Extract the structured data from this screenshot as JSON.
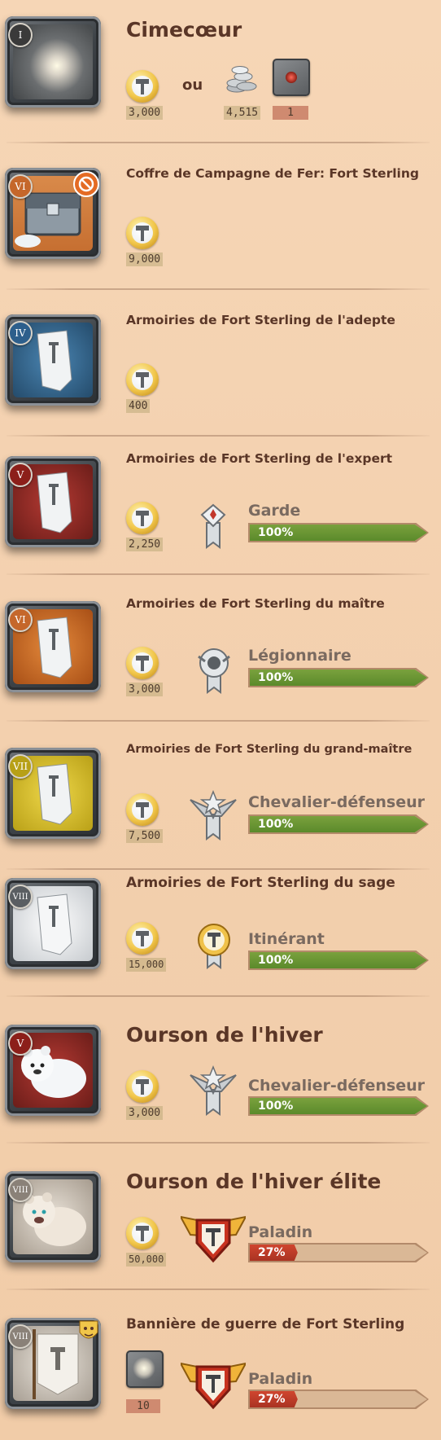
{
  "items": [
    {
      "tier": "I",
      "title": "Cimecœur",
      "price": "3,000",
      "ou": "ou",
      "alt_price": "4,515",
      "alt_count": "1"
    },
    {
      "tier": "VI",
      "title": "Coffre de Campagne de Fer: Fort Sterling",
      "price": "9,000"
    },
    {
      "tier": "IV",
      "title": "Armoiries de Fort Sterling de l'adepte",
      "price": "400"
    },
    {
      "tier": "V",
      "title": "Armoiries de Fort Sterling de l'expert",
      "price": "2,250",
      "rank": "Garde",
      "progress_label": "100%",
      "progress": 1.0
    },
    {
      "tier": "VI",
      "title": "Armoiries de Fort Sterling du maître",
      "price": "3,000",
      "rank": "Légionnaire",
      "progress_label": "100%",
      "progress": 1.0
    },
    {
      "tier": "VII",
      "title": "Armoiries de Fort Sterling du grand-maître",
      "price": "7,500",
      "rank": "Chevalier-défenseur",
      "progress_label": "100%",
      "progress": 1.0
    },
    {
      "tier": "VIII",
      "title": "Armoiries de Fort Sterling du sage",
      "price": "15,000",
      "rank": "Itinérant",
      "progress_label": "100%",
      "progress": 1.0
    },
    {
      "tier": "V",
      "title": "Ourson de l'hiver",
      "price": "3,000",
      "rank": "Chevalier-défenseur",
      "progress_label": "100%",
      "progress": 1.0
    },
    {
      "tier": "VIII",
      "title": "Ourson de l'hiver élite",
      "price": "50,000",
      "rank": "Paladin",
      "progress_label": "27%",
      "progress": 0.27
    },
    {
      "tier": "VIII",
      "title": "Bannière de guerre de Fort Sterling",
      "price": "10",
      "rank": "Paladin",
      "progress_label": "27%",
      "progress": 0.27
    }
  ],
  "icons": {
    "currency": "hammer-coin-icon",
    "silver": "silver-coins-icon",
    "rank_badges": [
      "garde-badge-icon",
      "legionnaire-badge-icon",
      "chevalier-badge-icon",
      "itinerant-badge-icon",
      "paladin-badge-icon"
    ]
  },
  "colors": {
    "progress_full": "#5b8a2b",
    "progress_partial": "#a93322",
    "background": "#f3d0ae"
  }
}
